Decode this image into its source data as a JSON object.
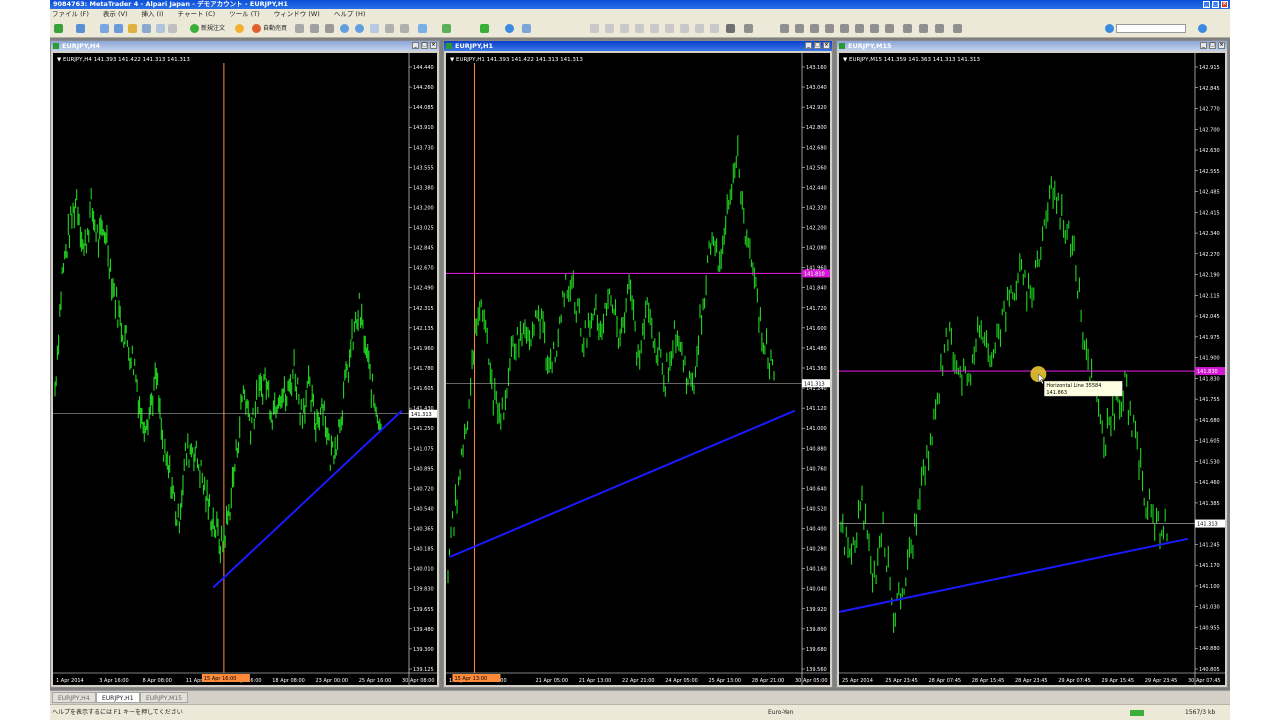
{
  "window": {
    "title": "9084763: MetaTrader 4 - Alpari Japan - デモアカウント - EURJPY,H1"
  },
  "menu": [
    "ファイル (F)",
    "表示 (V)",
    "挿入 (I)",
    "チャート (C)",
    "ツール (T)",
    "ウィンドウ (W)",
    "ヘルプ (H)"
  ],
  "toolbar": {
    "new_order": "新規注文",
    "auto_trading": "自動売買"
  },
  "charts": [
    {
      "id": "h4",
      "window_title": "EURJPY,H4",
      "info": "EURJPY,H4  141.393 141.422 141.313 141.313",
      "active": false,
      "y_labels": [
        "144.440",
        "144.260",
        "144.085",
        "143.910",
        "143.730",
        "143.555",
        "143.380",
        "143.200",
        "143.025",
        "142.845",
        "142.670",
        "142.490",
        "142.315",
        "142.135",
        "141.960",
        "141.780",
        "141.605",
        "141.430",
        "141.250",
        "141.075",
        "140.895",
        "140.720",
        "140.540",
        "140.365",
        "140.185",
        "140.010",
        "139.830",
        "139.655",
        "139.480",
        "139.300",
        "139.125"
      ],
      "x_labels": [
        "1 Apr 2014",
        "3 Apr 16:00",
        "8 Apr 08:00",
        "11 Apr 00:00",
        "15 Apr 16:00",
        "18 Apr 08:00",
        "23 Apr 00:00",
        "25 Apr 16:00",
        "30 Apr 08:00"
      ],
      "price_label": "141.313",
      "highlight_label": "15 Apr 16:00",
      "price_series": [
        141.6,
        142.6,
        143.0,
        143.3,
        142.8,
        143.2,
        142.9,
        143.0,
        142.5,
        142.2,
        142.0,
        141.8,
        141.3,
        141.4,
        141.7,
        141.0,
        140.8,
        140.4,
        141.0,
        141.1,
        140.9,
        140.6,
        140.4,
        140.2,
        140.5,
        141.0,
        141.6,
        141.3,
        141.5,
        141.7,
        141.4,
        141.6,
        141.5,
        141.8,
        141.4,
        141.6,
        141.3,
        141.5,
        141.0,
        141.2,
        141.6,
        142.0,
        142.3,
        141.9,
        141.5,
        141.3
      ]
    },
    {
      "id": "h1",
      "window_title": "EURJPY,H1",
      "info": "EURJPY,H1  141.393 141.422 141.313 141.313",
      "active": true,
      "y_labels": [
        "143.160",
        "143.040",
        "142.920",
        "142.800",
        "142.680",
        "142.560",
        "142.440",
        "142.320",
        "142.200",
        "142.080",
        "141.960",
        "141.840",
        "141.720",
        "141.600",
        "141.480",
        "141.360",
        "141.240",
        "141.120",
        "141.000",
        "140.880",
        "140.760",
        "140.640",
        "140.520",
        "140.400",
        "140.280",
        "140.160",
        "140.040",
        "139.920",
        "139.800",
        "139.680",
        "139.560"
      ],
      "x_labels": [
        "15 Apr 13:00",
        "21:00",
        "21 Apr 05:00",
        "21 Apr 13:00",
        "22 Apr 21:00",
        "24 Apr 05:00",
        "25 Apr 13:00",
        "28 Apr 21:00",
        "30 Apr 05:00"
      ],
      "price_label": "141.313",
      "magenta_label": "141.810",
      "highlight_label": "15 Apr 13:00",
      "price_series": [
        140.2,
        140.6,
        141.0,
        141.6,
        141.7,
        141.2,
        141.1,
        141.4,
        141.6,
        141.5,
        141.7,
        141.4,
        141.5,
        141.9,
        141.8,
        141.5,
        141.7,
        141.6,
        141.8,
        141.5,
        141.9,
        141.4,
        141.7,
        141.5,
        141.3,
        141.6,
        141.4,
        141.2,
        141.7,
        142.1,
        142.0,
        142.4,
        142.6,
        142.1,
        141.8,
        141.5,
        141.3
      ]
    },
    {
      "id": "m15",
      "window_title": "EURJPY,M15",
      "info": "EURJPY,M15  141.359 141.363 141.313 141.313",
      "active": false,
      "y_labels": [
        "142.915",
        "142.845",
        "142.770",
        "142.700",
        "142.630",
        "142.555",
        "142.485",
        "142.415",
        "142.340",
        "142.270",
        "142.190",
        "142.115",
        "142.045",
        "141.975",
        "141.900",
        "141.830",
        "141.755",
        "141.680",
        "141.605",
        "141.530",
        "141.460",
        "141.385",
        "141.315",
        "141.245",
        "141.170",
        "141.100",
        "141.030",
        "140.955",
        "140.880",
        "140.805"
      ],
      "x_labels": [
        "25 Apr 2014",
        "25 Apr 23:45",
        "28 Apr 07:45",
        "28 Apr 15:45",
        "28 Apr 23:45",
        "29 Apr 07:45",
        "29 Apr 15:45",
        "29 Apr 23:45",
        "30 Apr 07:45"
      ],
      "price_label": "141.313",
      "magenta_label": "141.830",
      "tooltip_line1": "Horizontal Line 35584",
      "tooltip_line2": "141.863",
      "price_series": [
        141.3,
        141.2,
        141.4,
        141.1,
        141.3,
        141.0,
        141.1,
        141.3,
        141.5,
        141.7,
        142.0,
        141.9,
        141.8,
        142.0,
        141.9,
        142.0,
        142.1,
        142.2,
        142.1,
        142.3,
        142.5,
        142.4,
        142.3,
        142.0,
        141.8,
        141.6,
        141.7,
        141.8,
        141.6,
        141.4,
        141.3,
        141.3
      ]
    }
  ],
  "tabs": [
    "EURJPY,H4",
    "EURJPY,H1",
    "EURJPY,M15"
  ],
  "status": {
    "help_text": "ヘルプを表示するには F1 キーを押してください",
    "profile": "Euro-Yen",
    "traffic": "1567/3 kb"
  },
  "colors": {
    "candles": "#1fd51f",
    "trendline": "#1a1aff",
    "horizontal": "#d21ad2",
    "vline": "#ff8a3a",
    "price_line": "#c8c8c8",
    "bg": "#000000"
  }
}
